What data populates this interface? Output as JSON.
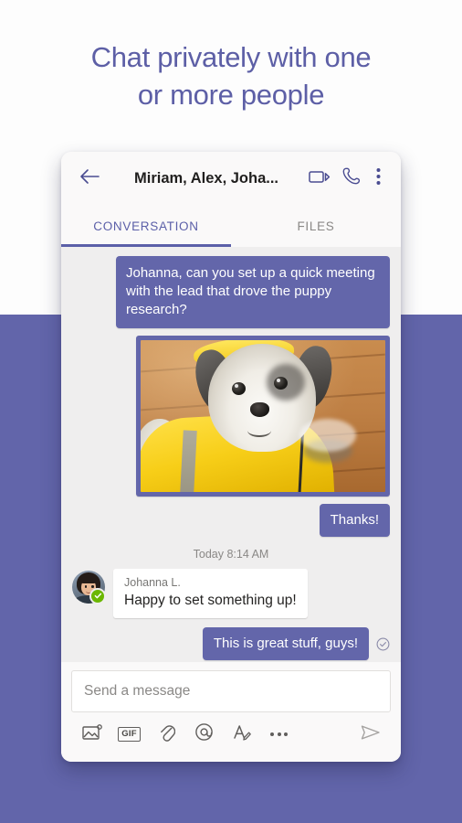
{
  "headline": {
    "line1": "Chat privately with one",
    "line2": "or more people"
  },
  "colors": {
    "brand_purple": "#6265AA",
    "bubble_purple": "#6366AA",
    "headline_purple": "#5D5FA6",
    "accent_tab": "#5B5FA8",
    "presence_green": "#6BB700",
    "conversation_bg": "#EFEEEE",
    "card_bg": "#FAF9F9"
  },
  "header": {
    "back_icon": "back-arrow-icon",
    "title": "Miriam, Alex, Joha...",
    "video_icon": "video-call-icon",
    "call_icon": "audio-call-icon",
    "overflow_icon": "more-vertical-icon"
  },
  "tabs": [
    {
      "label": "CONVERSATION",
      "active": true
    },
    {
      "label": "FILES",
      "active": false
    }
  ],
  "conversation": {
    "messages": [
      {
        "type": "text",
        "direction": "outgoing",
        "text": "Johanna, can you set up a quick meeting with the lead that drove the puppy research?"
      },
      {
        "type": "image",
        "direction": "outgoing",
        "alt": "Shih Tzu puppy wearing a yellow raincoat on a wooden floor"
      },
      {
        "type": "text",
        "direction": "outgoing",
        "text": "Thanks!"
      }
    ],
    "timestamp_divider": "Today 8:14 AM",
    "incoming": {
      "avatar_name": "avatar-johanna",
      "presence": "available",
      "presence_icon": "check-badge-icon",
      "sender": "Johanna L.",
      "text": "Happy to set something up!"
    },
    "last_outgoing": {
      "text": "This is great stuff, guys!",
      "receipt_icon": "read-receipt-check-icon"
    }
  },
  "compose": {
    "placeholder": "Send a message",
    "value": "",
    "tools": [
      {
        "name": "image-icon",
        "label": ""
      },
      {
        "name": "gif-icon",
        "label": "GIF"
      },
      {
        "name": "attachment-icon",
        "label": ""
      },
      {
        "name": "mention-icon",
        "label": ""
      },
      {
        "name": "format-text-icon",
        "label": ""
      },
      {
        "name": "more-options-icon",
        "label": ""
      }
    ],
    "send_icon": "send-icon"
  }
}
